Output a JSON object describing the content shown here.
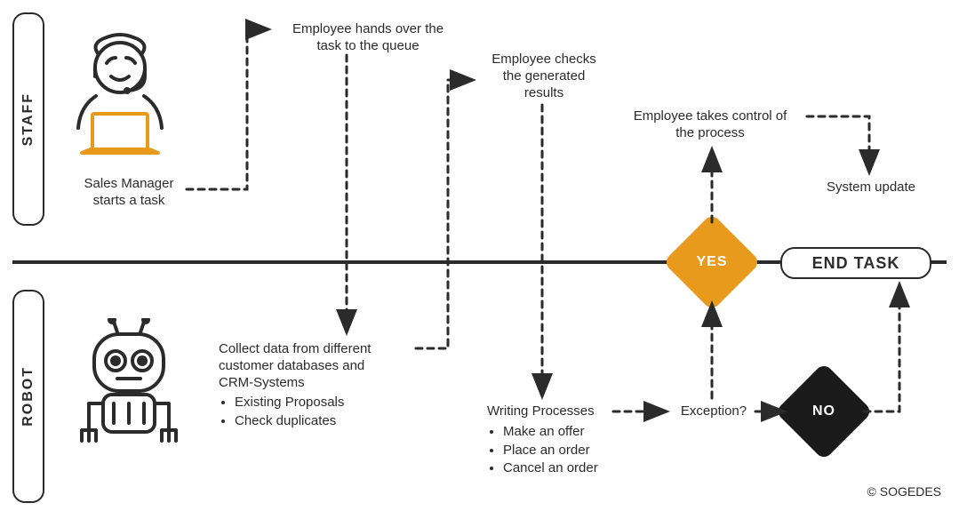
{
  "lanes": {
    "staff": "STAFF",
    "robot": "ROBOT"
  },
  "staff": {
    "start_task": "Sales Manager\nstarts a task",
    "hand_over": "Employee hands over the\ntask to the queue",
    "check_results": "Employee checks\nthe generated\nresults",
    "take_control": "Employee takes control of\nthe process",
    "system_update": "System update"
  },
  "robot": {
    "collect_data": "Collect data from different\ncustomer databases and\nCRM-Systems",
    "collect_bullets": [
      "Existing Proposals",
      "Check duplicates"
    ],
    "writing_title": "Writing Processes",
    "writing_bullets": [
      "Make an offer",
      "Place an order",
      "Cancel an order"
    ],
    "exception": "Exception?"
  },
  "decision": {
    "yes": "YES",
    "no": "NO"
  },
  "end_task": "END TASK",
  "copyright": "© SOGEDES",
  "colors": {
    "accent": "#e89a1d",
    "dark": "#1a1a1a",
    "line": "#2b2b2b"
  }
}
